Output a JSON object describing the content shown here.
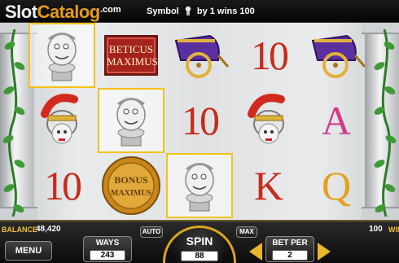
{
  "brand": {
    "name_part1": "Slot",
    "name_part2": "Catalog",
    "suffix": ".com"
  },
  "win_message": {
    "prefix": "Symbol",
    "suffix": "by 1 wins 100",
    "symbol_icon": "bust-icon"
  },
  "reels": [
    [
      {
        "type": "bust",
        "win": true
      },
      {
        "type": "centurion",
        "win": false
      },
      {
        "type": "ten",
        "text": "10",
        "win": false
      }
    ],
    [
      {
        "type": "sign",
        "text1": "BETICUS",
        "text2": "MAXIMUS",
        "win": false
      },
      {
        "type": "bust",
        "win": true
      },
      {
        "type": "bonus",
        "text1": "BONUS",
        "text2": "MAXIMUS",
        "win": false
      }
    ],
    [
      {
        "type": "chariot",
        "win": false
      },
      {
        "type": "ten",
        "text": "10",
        "win": false
      },
      {
        "type": "bust",
        "win": true
      }
    ],
    [
      {
        "type": "ten",
        "text": "10",
        "win": false
      },
      {
        "type": "centurion",
        "win": false
      },
      {
        "type": "k",
        "text": "K",
        "win": false
      }
    ],
    [
      {
        "type": "chariot",
        "win": false
      },
      {
        "type": "a",
        "text": "A",
        "win": false
      },
      {
        "type": "q",
        "text": "Q",
        "win": false
      }
    ]
  ],
  "controls": {
    "balance_label": "BALANCE",
    "balance_value": "48,420",
    "menu_label": "MENU",
    "ways_label": "WAYS",
    "ways_value": "243",
    "auto_label": "AUTO",
    "spin_label": "SPIN",
    "spin_value": "88",
    "max_label": "MAX",
    "bet_per_label": "BET PER",
    "bet_per_value": "2",
    "win_value": "100",
    "win_label": "WIN"
  },
  "colors": {
    "accent_gold": "#f2c23d",
    "letter_red": "#c62b1c",
    "highlight_yellow": "#f3c21a"
  }
}
